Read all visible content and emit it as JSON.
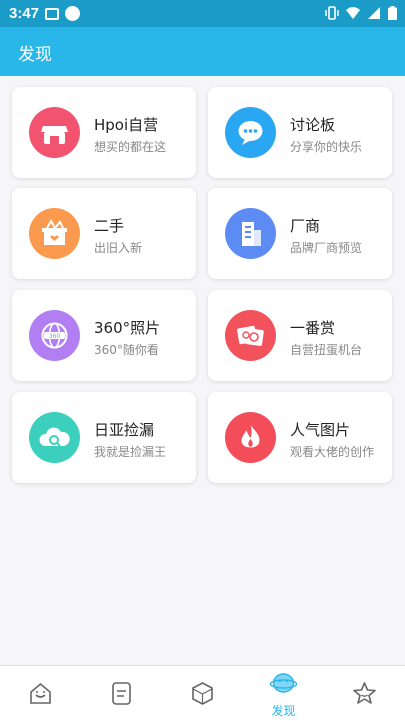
{
  "status_bar": {
    "time": "3:47"
  },
  "app_bar": {
    "title": "发现"
  },
  "cards": [
    {
      "name": "Hpoi自营",
      "subtitle": "想买的都在这",
      "icon": "store-icon",
      "color": "#f2536f"
    },
    {
      "name": "讨论板",
      "subtitle": "分享你的快乐",
      "icon": "chat-icon",
      "color": "#2aa7f2"
    },
    {
      "name": "二手",
      "subtitle": "出旧入新",
      "icon": "secondhand-box-icon",
      "color": "#fb9a4f"
    },
    {
      "name": "厂商",
      "subtitle": "品牌厂商预览",
      "icon": "building-icon",
      "color": "#5b8bf3"
    },
    {
      "name": "360°照片",
      "subtitle": "360°随你看",
      "icon": "360-view-icon",
      "color": "#b27ff3"
    },
    {
      "name": "一番赏",
      "subtitle": "自营扭蛋机台",
      "icon": "lottery-ticket-icon",
      "color": "#f2525c"
    },
    {
      "name": "日亚捡漏",
      "subtitle": "我就是捡漏王",
      "icon": "cloud-search-icon",
      "color": "#3ccfbd"
    },
    {
      "name": "人气图片",
      "subtitle": "观看大佬的创作",
      "icon": "flame-icon",
      "color": "#f24d58"
    }
  ],
  "bottom_nav": {
    "tabs": [
      {
        "icon": "home-icon",
        "label": ""
      },
      {
        "icon": "document-icon",
        "label": ""
      },
      {
        "icon": "cube-icon",
        "label": ""
      },
      {
        "icon": "planet-icon",
        "label": "发现",
        "active": true
      },
      {
        "icon": "star-icon",
        "label": ""
      }
    ]
  }
}
